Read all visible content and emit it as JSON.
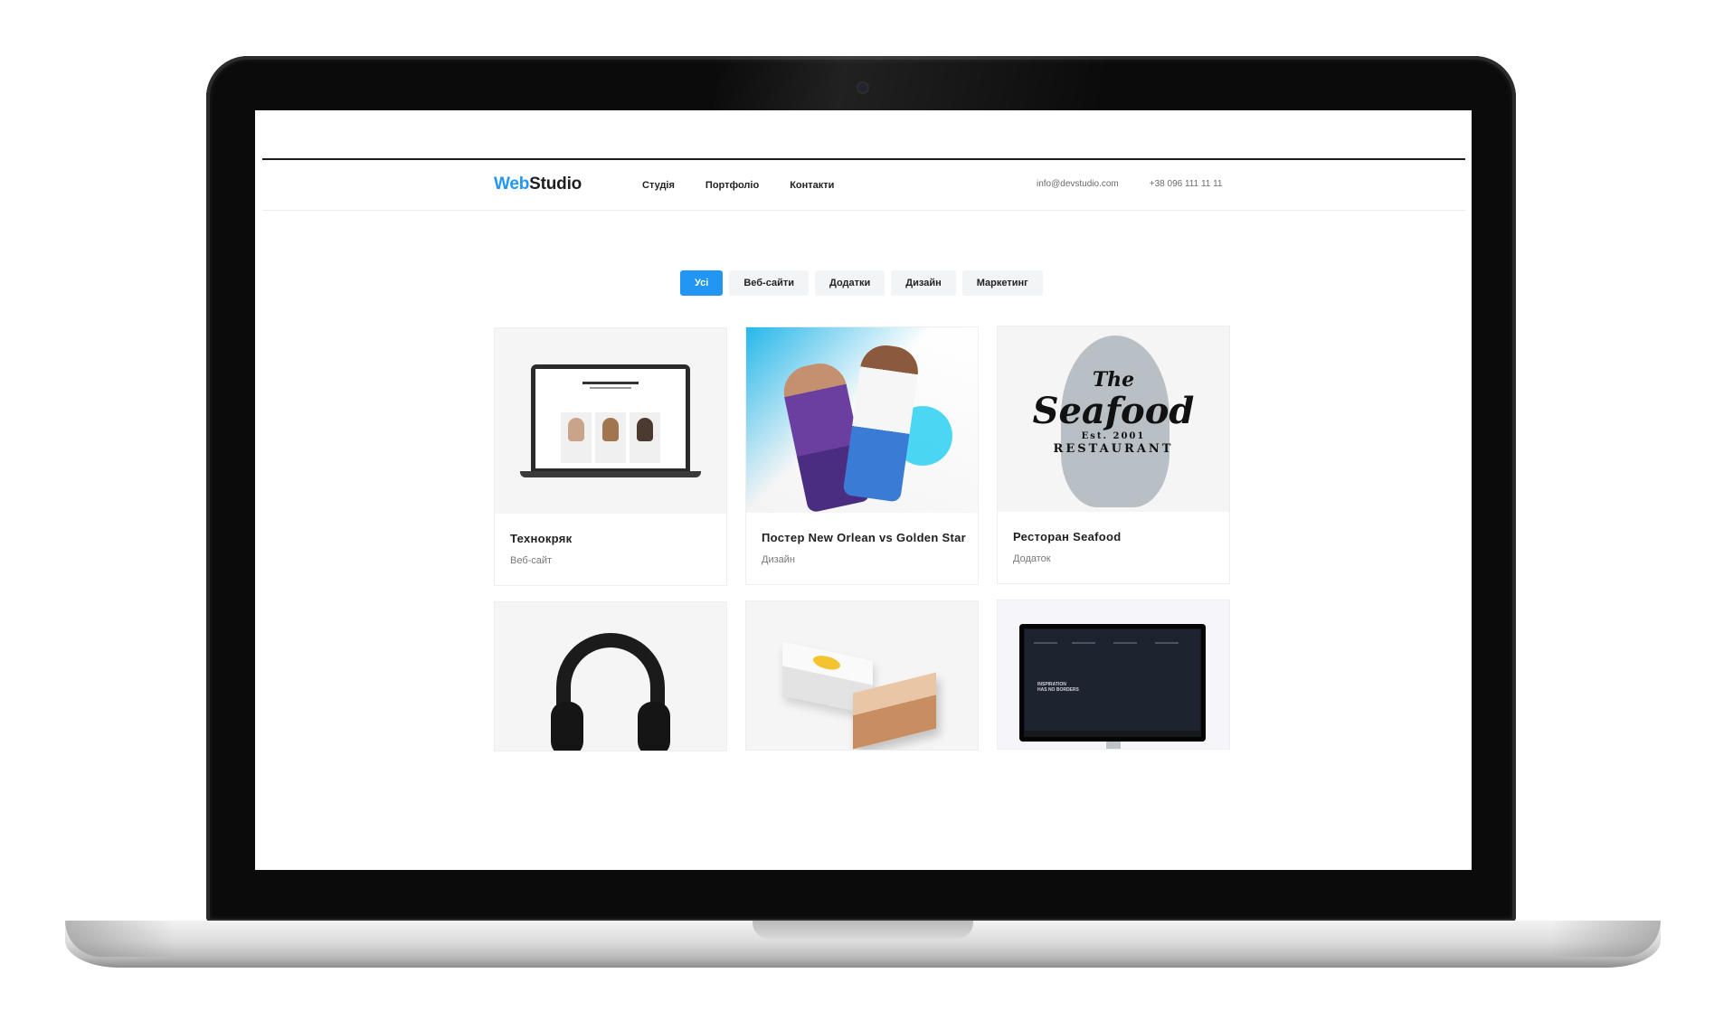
{
  "site": {
    "logo_accent": "Web",
    "logo_rest": "Studio",
    "nav": [
      "Студія",
      "Портфоліо",
      "Контакти"
    ],
    "email": "info@devstudio.com",
    "phone": "+38 096 111 11 11"
  },
  "filters": [
    {
      "label": "Усі",
      "active": true
    },
    {
      "label": "Веб-сайти",
      "active": false
    },
    {
      "label": "Додатки",
      "active": false
    },
    {
      "label": "Дизайн",
      "active": false
    },
    {
      "label": "Маркетинг",
      "active": false
    }
  ],
  "portfolio": [
    {
      "title": "Технокряк",
      "category": "Веб-сайт",
      "thumb": "laptop-website-mockup"
    },
    {
      "title": "Постер New Orlean vs Golden Star",
      "category": "Дизайн",
      "thumb": "basketball-poster"
    },
    {
      "title": "Ресторан Seafood",
      "category": "Додаток",
      "thumb": "seafood-logo"
    },
    {
      "title": "",
      "category": "",
      "thumb": "headphones"
    },
    {
      "title": "",
      "category": "",
      "thumb": "packaging-boxes"
    },
    {
      "title": "",
      "category": "",
      "thumb": "monitor-website"
    }
  ],
  "thumb_text": {
    "seafood_the": "The",
    "seafood_word": "Seafood",
    "seafood_est": "Est. 2001",
    "seafood_restaurant": "RESTAURANT",
    "monitor_heading": "INSPIRATION\nHAS NO BORDERS"
  },
  "colors": {
    "accent": "#2196f3",
    "filter_bg": "#f3f4f6"
  }
}
